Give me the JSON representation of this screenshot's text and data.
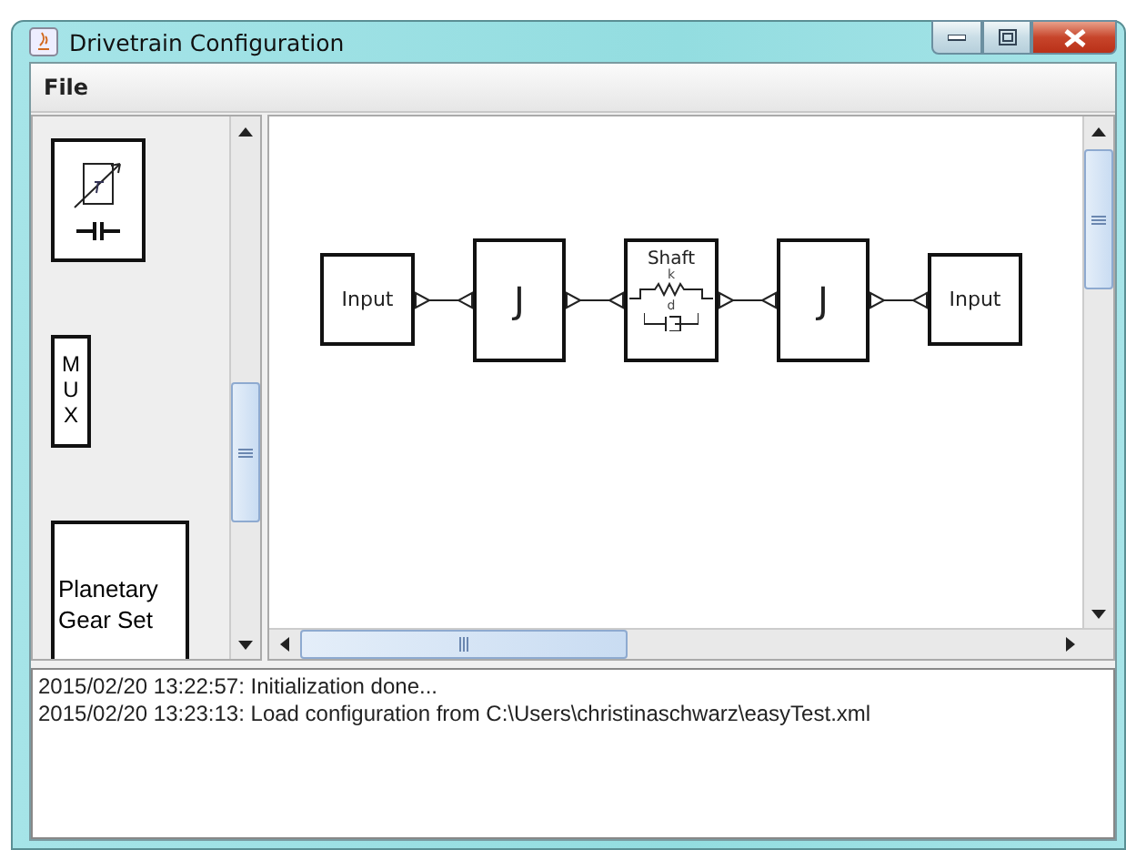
{
  "window": {
    "title": "Drivetrain Configuration"
  },
  "menu": [
    "File"
  ],
  "palette": [
    {
      "kind": "sensor"
    },
    {
      "kind": "mux",
      "label": "MUX"
    },
    {
      "kind": "block",
      "label": "Planetary Gear Set"
    }
  ],
  "diagram": {
    "nodes": [
      {
        "kind": "input",
        "label": "Input"
      },
      {
        "kind": "inertia",
        "label": "J"
      },
      {
        "kind": "shaft",
        "label": "Shaft",
        "spring_label": "k",
        "damper_label": "d"
      },
      {
        "kind": "inertia",
        "label": "J"
      },
      {
        "kind": "input",
        "label": "Input"
      }
    ]
  },
  "log": [
    "2015/02/20 13:22:57: Initialization done...",
    "2015/02/20 13:23:13: Load configuration from C:\\Users\\christinaschwarz\\easyTest.xml"
  ]
}
